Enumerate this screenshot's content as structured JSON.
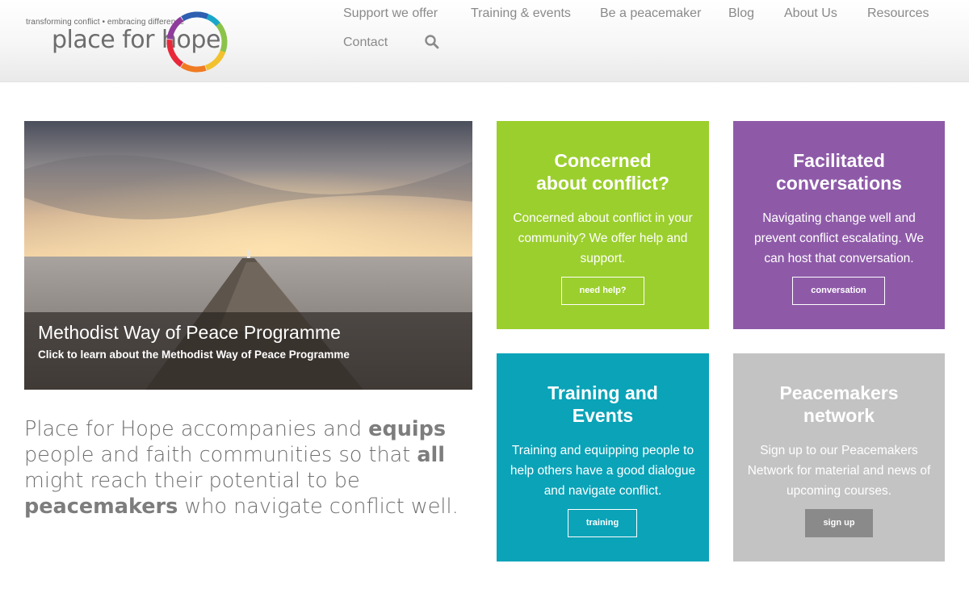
{
  "logo": {
    "tagline": "transforming conflict • embracing difference",
    "name": "place for hope"
  },
  "nav": {
    "items": [
      "Support we offer",
      "Training & events",
      "Be a peacemaker",
      "Blog",
      "About Us",
      "Resources",
      "Contact"
    ],
    "search_icon": "search-icon"
  },
  "hero": {
    "title": "Methodist Way of Peace Programme",
    "subtitle": "Click to learn about the Methodist Way of Peace Programme"
  },
  "intro": {
    "part1": "Place for Hope accompanies and ",
    "bold1": "equips",
    "part2": " people and faith communities so that ",
    "bold2": "all",
    "part3": " might reach their potential to be ",
    "bold3": "peacemakers",
    "part4": " who navigate conflict well."
  },
  "cards": [
    {
      "title": "Concerned about conflict?",
      "text": "Concerned about conflict in your community? We offer help and support.",
      "button": "need help?",
      "color": "#9bcf2d"
    },
    {
      "title": "Facilitated conversations",
      "text": "Navigating change well and prevent conflict escalating. We can host that conversation.",
      "button": "conversation",
      "color": "#8e5aa8"
    },
    {
      "title": "Training and Events",
      "text": "Training and equipping people to help others have a good dialogue and navigate conflict.",
      "button": "training",
      "color": "#0aa3b8"
    },
    {
      "title": "Peacemakers network",
      "text": "Sign up to our Peacemakers Network for material and news of upcoming courses.",
      "button": "sign up",
      "color": "#c3c3c3"
    }
  ]
}
